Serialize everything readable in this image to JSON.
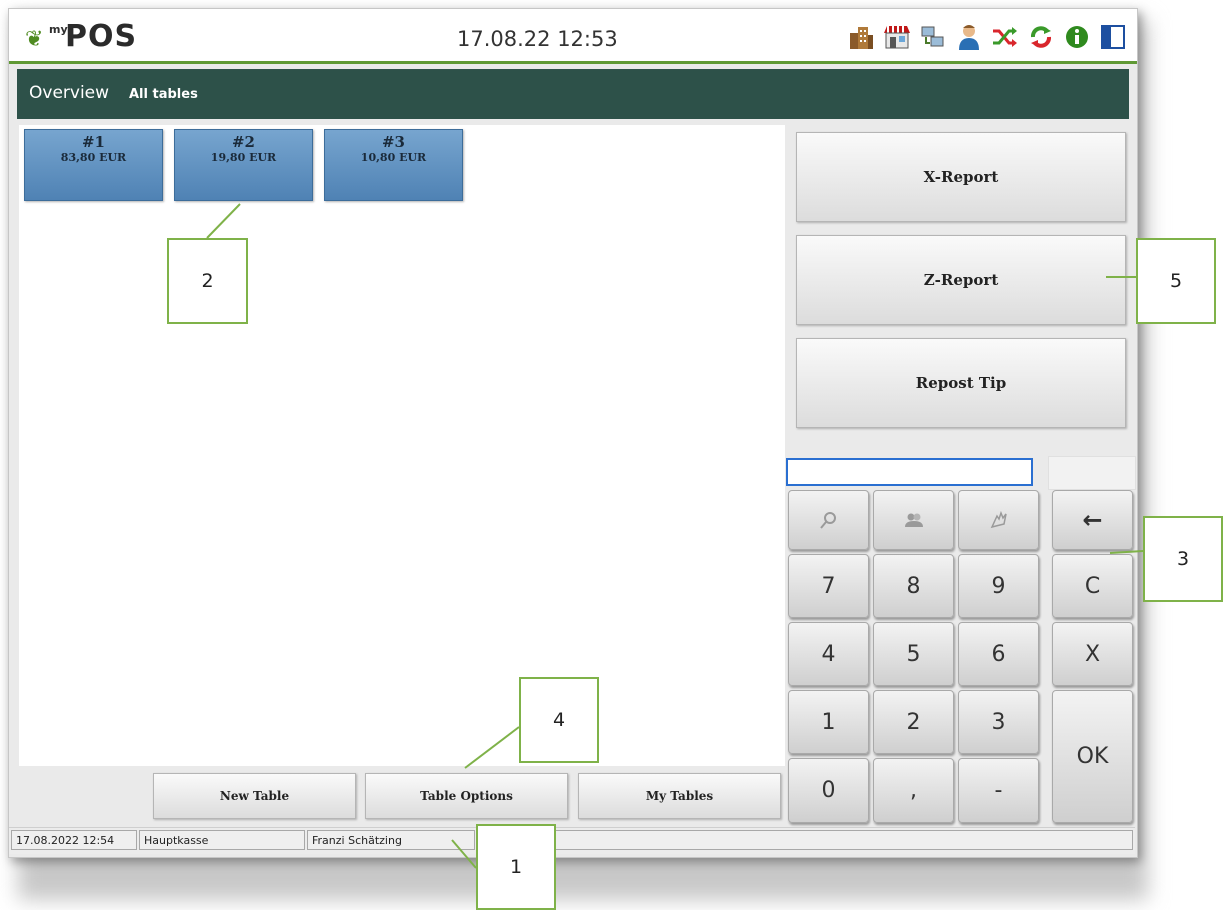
{
  "titlebar": {
    "logo_my": "my",
    "logo_pos": "POS",
    "datetime": "17.08.22  12:53",
    "icons": [
      "building-icon",
      "shop-icon",
      "network-icon",
      "user-icon",
      "shuffle-icon",
      "refresh-icon",
      "info-icon",
      "panel-icon"
    ]
  },
  "header": {
    "title": "Overview",
    "subtitle": "All tables"
  },
  "tables": [
    {
      "number": "#1",
      "amount": "83,80 EUR"
    },
    {
      "number": "#2",
      "amount": "19,80 EUR"
    },
    {
      "number": "#3",
      "amount": "10,80 EUR"
    }
  ],
  "reports": {
    "x_report": "X-Report",
    "z_report": "Z-Report",
    "repost_tip": "Repost Tip"
  },
  "keypad": {
    "icon_keys": [
      "search-icon",
      "group-icon",
      "hand-icon"
    ],
    "backspace": "←",
    "digits": [
      "7",
      "8",
      "9",
      "4",
      "5",
      "6",
      "1",
      "2",
      "3",
      "0",
      ",",
      "-"
    ],
    "clear": "C",
    "cancel": "X",
    "ok": "OK"
  },
  "bottom_buttons": {
    "new_table": "New Table",
    "table_options": "Table Options",
    "my_tables": "My Tables"
  },
  "status": {
    "datetime": "17.08.2022 12:54",
    "register": "Hauptkasse",
    "user": "Franzi Schätzing"
  },
  "callouts": [
    "1",
    "2",
    "3",
    "4",
    "5"
  ],
  "colors": {
    "header": "#2d5149",
    "accent_green": "#5f9934",
    "table_tile": "#5b8cbf",
    "callout_border": "#7fb249"
  }
}
